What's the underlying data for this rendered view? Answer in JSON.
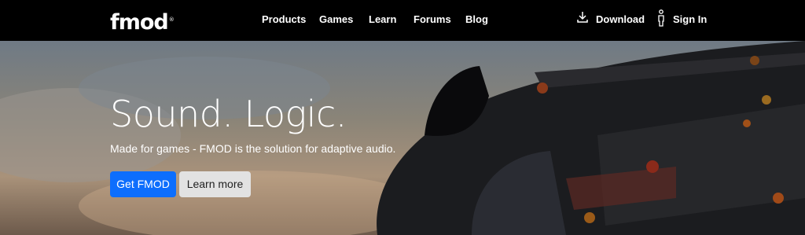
{
  "nav": {
    "logo_text": "fmod",
    "logo_mark": "®",
    "items": [
      {
        "label": "Products"
      },
      {
        "label": "Games"
      },
      {
        "label": "Learn"
      },
      {
        "label": "Forums"
      },
      {
        "label": "Blog"
      }
    ],
    "download_label": "Download",
    "download_icon": "download-icon",
    "signin_label": "Sign In",
    "signin_icon": "user-icon"
  },
  "hero": {
    "title": "Sound. Logic.",
    "subtitle": "Made for games - FMOD is the solution for adaptive audio.",
    "primary_button": "Get FMOD",
    "secondary_button": "Learn more"
  },
  "colors": {
    "nav_bg": "#000000",
    "primary": "#0d6efd",
    "secondary": "#e2e2e2"
  }
}
